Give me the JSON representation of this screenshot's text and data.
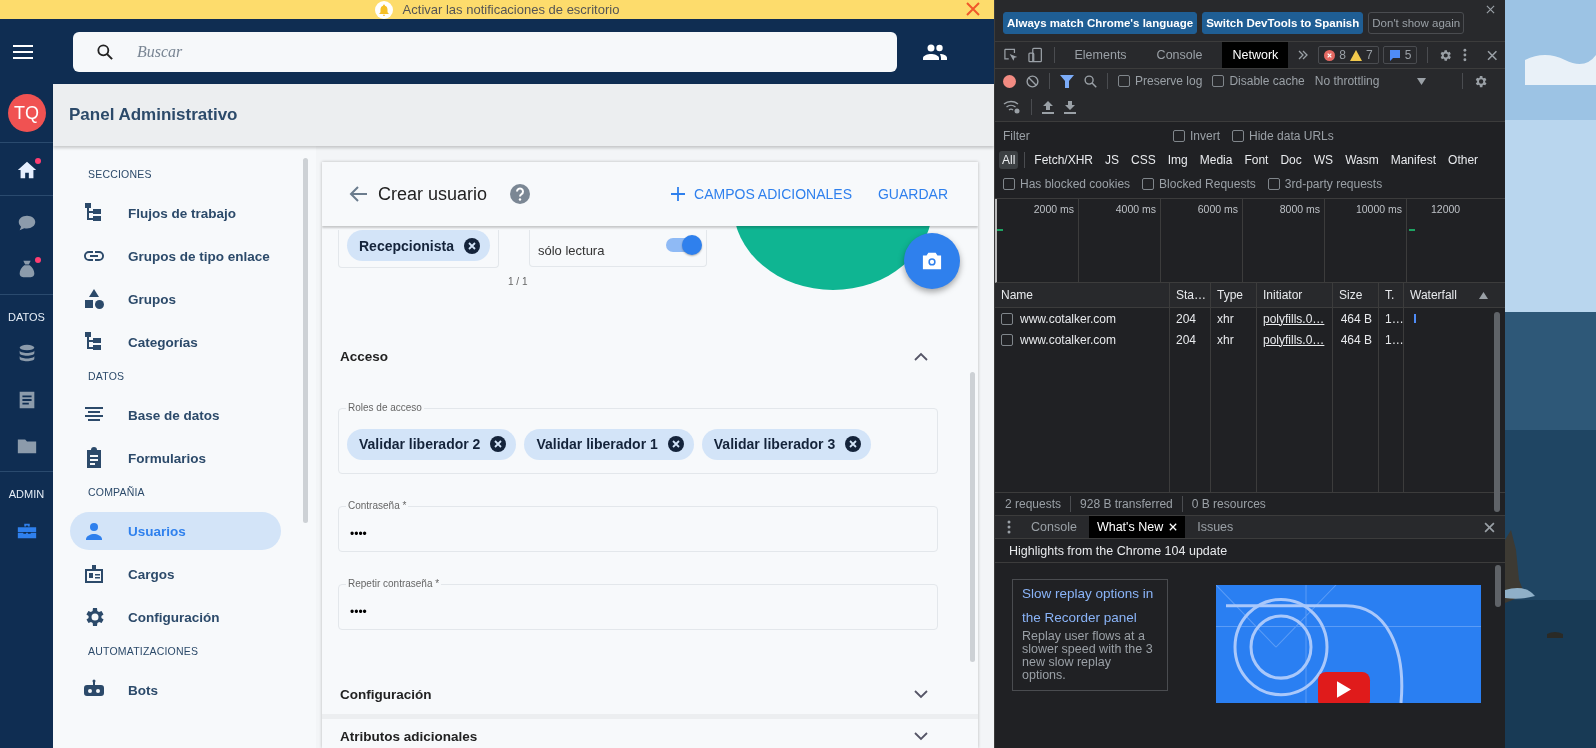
{
  "notification_banner": {
    "text": "Activar las notificaciones de escritorio"
  },
  "search": {
    "placeholder": "Buscar"
  },
  "title_bar": {
    "title": "Panel Administrativo"
  },
  "rail": {
    "avatar": "TQ",
    "groups": [
      {
        "items": [
          {
            "badge": true,
            "selected": false
          }
        ]
      },
      {
        "items": [
          {
            "badge": false,
            "selected": false
          },
          {
            "badge": true,
            "selected": false
          }
        ]
      },
      {
        "heading": "DATOS",
        "items": [
          {
            "badge": false,
            "selected": false
          },
          {
            "badge": false,
            "selected": false
          },
          {
            "badge": false,
            "selected": false
          }
        ]
      },
      {
        "heading": "ADMIN",
        "items": [
          {
            "badge": false,
            "selected": true
          }
        ]
      }
    ]
  },
  "sidebar": {
    "sections": [
      {
        "heading": "SECCIONES",
        "items": [
          {
            "label": "Flujos de trabajo",
            "selected": false
          },
          {
            "label": "Grupos de tipo enlace",
            "selected": false
          },
          {
            "label": "Grupos",
            "selected": false
          },
          {
            "label": "Categorías",
            "selected": false
          }
        ]
      },
      {
        "heading": "DATOS",
        "items": [
          {
            "label": "Base de datos",
            "selected": false
          },
          {
            "label": "Formularios",
            "selected": false
          }
        ]
      },
      {
        "heading": "COMPAÑIA",
        "items": [
          {
            "label": "Usuarios",
            "selected": true
          },
          {
            "label": "Cargos",
            "selected": false
          },
          {
            "label": "Configuración",
            "selected": false
          }
        ]
      },
      {
        "heading": "AUTOMATIZACIONES",
        "items": [
          {
            "label": "Bots",
            "selected": false
          }
        ]
      }
    ]
  },
  "form": {
    "title": "Crear usuario",
    "actions": [
      {
        "label": "CAMPOS ADICIONALES",
        "kind": "add"
      },
      {
        "label": "GUARDAR",
        "kind": "plain"
      }
    ],
    "role_chips": [
      {
        "label": "Recepcionista"
      }
    ],
    "readonly_toggle": {
      "label": "sólo lectura",
      "on": true
    },
    "counter": "1 / 1",
    "access": {
      "title": "Acceso",
      "expanded": true,
      "roles": {
        "label": "Roles de acceso",
        "chips": [
          {
            "label": "Validar liberador 2"
          },
          {
            "label": "Validar liberador 1"
          },
          {
            "label": "Validar liberador 3"
          }
        ]
      },
      "password": {
        "label": "Contraseña *",
        "value": "••••"
      },
      "repeat_password": {
        "label": "Repetir contraseña *",
        "value": "••••"
      }
    },
    "collapsed_sections": [
      {
        "title": "Configuración",
        "expanded": false
      },
      {
        "title": "Atributos adicionales",
        "expanded": false
      }
    ]
  },
  "devtools": {
    "language_banner": {
      "buttons": [
        {
          "label": "Always match Chrome's language",
          "kind": "primary"
        },
        {
          "label": "Switch DevTools to Spanish",
          "kind": "primary"
        },
        {
          "label": "Don't show again",
          "kind": "secondary"
        }
      ]
    },
    "tabs": [
      {
        "label": "Elements",
        "selected": false
      },
      {
        "label": "Console",
        "selected": false
      },
      {
        "label": "Network",
        "selected": true
      }
    ],
    "counters": {
      "errors": "8",
      "warnings": "7",
      "messages": "5"
    },
    "toolbar": {
      "recording": true,
      "checkboxes": [
        {
          "label": "Preserve log",
          "checked": false
        },
        {
          "label": "Disable cache",
          "checked": false
        }
      ],
      "throttling": "No throttling"
    },
    "filter": {
      "placeholder": "Filter",
      "checkboxes": [
        {
          "label": "Invert",
          "checked": false
        },
        {
          "label": "Hide data URLs",
          "checked": false
        }
      ]
    },
    "type_filters": [
      {
        "label": "All",
        "selected": true
      },
      {
        "label": "Fetch/XHR",
        "selected": false
      },
      {
        "label": "JS",
        "selected": false
      },
      {
        "label": "CSS",
        "selected": false
      },
      {
        "label": "Img",
        "selected": false
      },
      {
        "label": "Media",
        "selected": false
      },
      {
        "label": "Font",
        "selected": false
      },
      {
        "label": "Doc",
        "selected": false
      },
      {
        "label": "WS",
        "selected": false
      },
      {
        "label": "Wasm",
        "selected": false
      },
      {
        "label": "Manifest",
        "selected": false
      },
      {
        "label": "Other",
        "selected": false
      }
    ],
    "request_filters": [
      {
        "label": "Has blocked cookies",
        "checked": false
      },
      {
        "label": "Blocked Requests",
        "checked": false
      },
      {
        "label": "3rd-party requests",
        "checked": false
      }
    ],
    "overview": {
      "ticks": [
        "2000 ms",
        "4000 ms",
        "6000 ms",
        "8000 ms",
        "10000 ms",
        "12000"
      ]
    },
    "table": {
      "columns": [
        "Name",
        "Sta…",
        "Type",
        "Initiator",
        "Size",
        "T.",
        "Waterfall"
      ],
      "rows": [
        {
          "name": "www.cotalker.com",
          "status": "204",
          "type": "xhr",
          "initiator": "polyfills.0…",
          "size": "464 B",
          "time": "1…",
          "checked": false
        },
        {
          "name": "www.cotalker.com",
          "status": "204",
          "type": "xhr",
          "initiator": "polyfills.0…",
          "size": "464 B",
          "time": "1…",
          "checked": false
        }
      ]
    },
    "summary": [
      "2 requests",
      "928 B transferred",
      "0 B resources"
    ],
    "drawer": {
      "tabs": [
        {
          "label": "Console",
          "selected": false,
          "closable": false
        },
        {
          "label": "What's New",
          "selected": true,
          "closable": true
        },
        {
          "label": "Issues",
          "selected": false,
          "closable": false
        }
      ],
      "heading": "Highlights from the Chrome 104 update",
      "feature": {
        "title": "Slow replay options in the Recorder panel",
        "description": "Replay user flows at a slower speed with the 3 new slow replay options."
      }
    }
  }
}
